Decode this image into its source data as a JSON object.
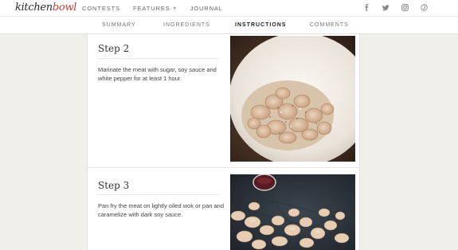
{
  "brand": {
    "prefix": "kitchen",
    "suffix": "bowl",
    "accent_color": "#d33b36"
  },
  "topnav": [
    {
      "label": "CONTESTS",
      "has_caret": false
    },
    {
      "label": "FEATURES",
      "has_caret": true
    },
    {
      "label": "JOURNAL",
      "has_caret": false
    }
  ],
  "social": [
    "facebook-icon",
    "twitter-icon",
    "instagram-icon",
    "pinterest-icon"
  ],
  "tabs": [
    {
      "label": "SUMMARY",
      "active": false
    },
    {
      "label": "INGREDIENTS",
      "active": false
    },
    {
      "label": "INSTRUCTIONS",
      "active": true
    },
    {
      "label": "COMMENTS",
      "active": false
    }
  ],
  "steps": [
    {
      "title": "Step 2",
      "text": "Marinate the meat with sugar, soy sauce and white pepper for at least 1 hour.",
      "image": "marinated-meat-bowl-photo"
    },
    {
      "title": "Step 3",
      "text": "Pan fry the meat on lightly oiled wok or pan and caramelize with dark soy sauce.",
      "image": "wok-frying-meat-photo"
    }
  ]
}
